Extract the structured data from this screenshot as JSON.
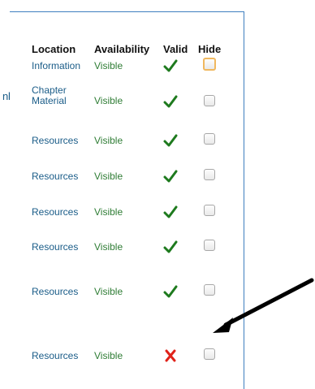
{
  "table": {
    "headers": {
      "location": "Location",
      "availability": "Availability",
      "valid": "Valid",
      "hide": "Hide"
    },
    "cut_text": "nl",
    "rows": [
      {
        "location": "Information",
        "availability": "Visible",
        "valid_icon": "check-icon",
        "hide_checked": false,
        "hide_focused": true
      },
      {
        "location": "Chapter Material",
        "availability": "Visible",
        "valid_icon": "check-icon",
        "hide_checked": false,
        "hide_focused": false
      },
      {
        "location": "Resources",
        "availability": "Visible",
        "valid_icon": "check-icon",
        "hide_checked": false,
        "hide_focused": false
      },
      {
        "location": "Resources",
        "availability": "Visible",
        "valid_icon": "check-icon",
        "hide_checked": false,
        "hide_focused": false
      },
      {
        "location": "Resources",
        "availability": "Visible",
        "valid_icon": "check-icon",
        "hide_checked": false,
        "hide_focused": false
      },
      {
        "location": "Resources",
        "availability": "Visible",
        "valid_icon": "check-icon",
        "hide_checked": false,
        "hide_focused": false
      },
      {
        "location": "Resources",
        "availability": "Visible",
        "valid_icon": "check-icon",
        "hide_checked": false,
        "hide_focused": false
      },
      {
        "location": "Resources",
        "availability": "Visible",
        "valid_icon": "x-icon",
        "hide_checked": false,
        "hide_focused": false
      }
    ]
  },
  "colors": {
    "panel_border": "#3f7fbf",
    "location_text": "#1a5c88",
    "availability_text": "#2f7d35",
    "check": "#1e7a1e",
    "cross": "#e0221a",
    "focus_ring": "#f0b85f",
    "arrow": "#000000"
  },
  "annotation": {
    "icon": "arrow-icon"
  }
}
